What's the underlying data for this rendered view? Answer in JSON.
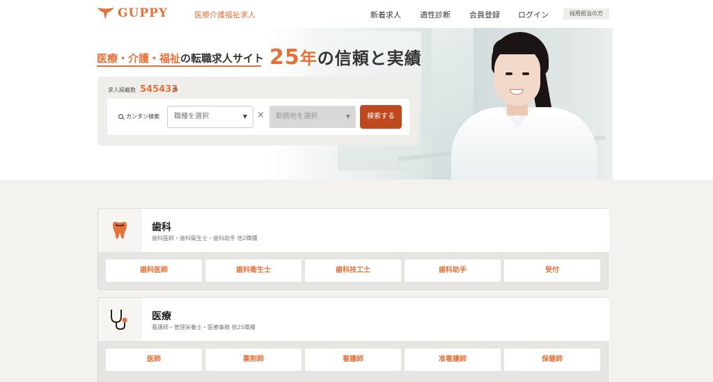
{
  "header": {
    "logo_text": "GUPPY",
    "subtitle": "医療介護福祉求人",
    "nav": [
      "新着求人",
      "適性診断",
      "会員登録",
      "ログイン"
    ],
    "recruiter_label": "採用担当の方"
  },
  "hero": {
    "tagline_orange": "医療・介護・福祉",
    "tagline_rest": "の転職求人サイト",
    "trust_num": "25",
    "trust_year": "年",
    "trust_rest": "の信頼と実績"
  },
  "search": {
    "count_label": "求人掲載数",
    "count_value": "545433",
    "count_unit": "件",
    "label": "カンタン検索",
    "job_placeholder": "職種を選択",
    "location_placeholder": "勤務地を選択",
    "times": "×",
    "button": "検索する",
    "arrow": "▼"
  },
  "categories": [
    {
      "title": "歯科",
      "desc": "歯科医師・歯科衛生士・歯科助手 他2職種",
      "icon": "tooth-icon",
      "chips": [
        "歯科医師",
        "歯科衛生士",
        "歯科技工士",
        "歯科助手",
        "受付"
      ]
    },
    {
      "title": "医療",
      "desc": "看護師・管理栄養士・医療事務 他25職種",
      "icon": "stethoscope-icon",
      "chips": [
        "医師",
        "薬剤師",
        "看護師",
        "准看護師",
        "保健師"
      ]
    }
  ],
  "colors": {
    "brand": "#e4703a",
    "button": "#c0481e",
    "background": "#f3f2ef"
  }
}
